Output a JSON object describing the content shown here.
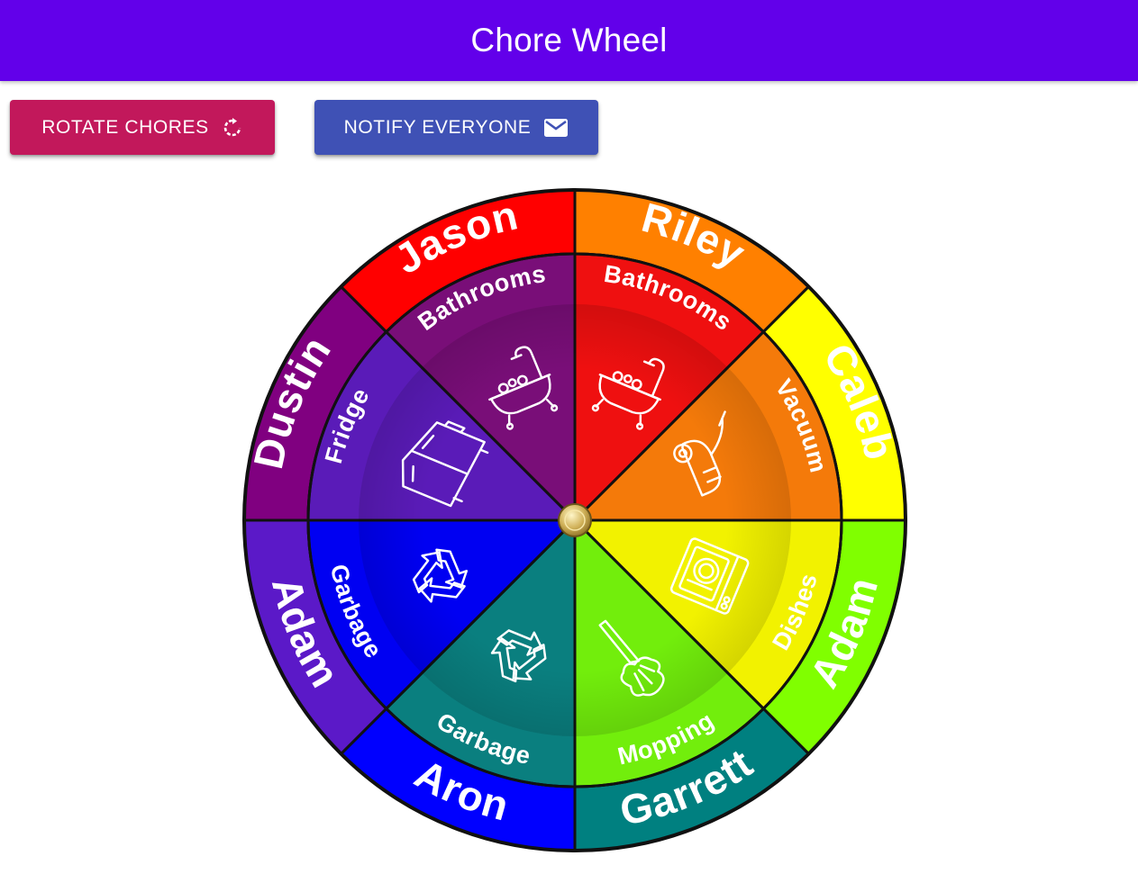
{
  "app": {
    "title": "Chore Wheel"
  },
  "toolbar": {
    "rotate_label": "ROTATE CHORES",
    "rotate_icon": "rotate-icon",
    "notify_label": "NOTIFY EVERYONE",
    "notify_icon": "mail-icon",
    "rotate_color": "#c2185b",
    "notify_color": "#3f51b5",
    "appbar_color": "#6200ea"
  },
  "wheel": {
    "people": [
      {
        "name": "Riley",
        "color": "#ff8000"
      },
      {
        "name": "Caleb",
        "color": "#ffff00"
      },
      {
        "name": "Adam",
        "color": "#80ff00"
      },
      {
        "name": "Garrett",
        "color": "#008080"
      },
      {
        "name": "Aron",
        "color": "#0000ff"
      },
      {
        "name": "Adam",
        "color": "#5b19c8"
      },
      {
        "name": "Dustin",
        "color": "#800080"
      },
      {
        "name": "Jason",
        "color": "#ff0000"
      }
    ],
    "chores": [
      {
        "name": "Bathrooms",
        "color": "#ef1010",
        "icon": "bathtub-icon"
      },
      {
        "name": "Vacuum",
        "color": "#f47a0a",
        "icon": "vacuum-icon"
      },
      {
        "name": "Dishes",
        "color": "#f2f200",
        "icon": "dishwasher-icon"
      },
      {
        "name": "Mopping",
        "color": "#72ee0c",
        "icon": "duster-icon"
      },
      {
        "name": "Garbage",
        "color": "#0a7f7f",
        "icon": "recycle-icon"
      },
      {
        "name": "Garbage",
        "color": "#0000f2",
        "icon": "recycle-icon"
      },
      {
        "name": "Fridge",
        "color": "#5a1bb8",
        "icon": "fridge-icon"
      },
      {
        "name": "Bathrooms",
        "color": "#790e78",
        "icon": "bathtub-icon"
      }
    ]
  }
}
